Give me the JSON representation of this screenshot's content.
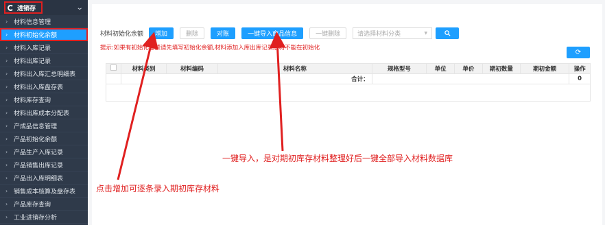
{
  "sidebar": {
    "title": "进销存",
    "items": [
      {
        "label": "材料信息管理"
      },
      {
        "label": "材料初始化余额"
      },
      {
        "label": "材料入库记录"
      },
      {
        "label": "材料出库记录"
      },
      {
        "label": "材料出入库汇总明细表"
      },
      {
        "label": "材料出入库盘存表"
      },
      {
        "label": "材料库存查询"
      },
      {
        "label": "材料出库成本分配表"
      },
      {
        "label": "产成品信息管理"
      },
      {
        "label": "产品初始化余额"
      },
      {
        "label": "产品生产入库记录"
      },
      {
        "label": "产品销售出库记录"
      },
      {
        "label": "产品出入库明细表"
      },
      {
        "label": "销售成本核算及盘存表"
      },
      {
        "label": "产品库存查询"
      },
      {
        "label": "工业进销存分析"
      }
    ]
  },
  "toolbar": {
    "label": "材料初始化余额",
    "add": "增加",
    "delete": "删除",
    "reconcile": "对账",
    "import": "一键导入商品信息",
    "delete_all": "一键删除",
    "category_placeholder": "请选择材料分类"
  },
  "hint": "提示:如果有初始化金额请先填写初始化余额,材料添加入库出库记录后将不能在初始化",
  "table": {
    "headers": [
      "材料类别",
      "材料编码",
      "材料名称",
      "规格型号",
      "单位",
      "单价",
      "期初数量",
      "期初金额",
      "操作"
    ],
    "total_label": "合计：",
    "total_value": "0"
  },
  "annotations": {
    "import_note": "一键导入，是对期初库存材料整理好后一键全部导入材料数据库",
    "add_note": "点击增加可逐条录入期初库存材料"
  },
  "colors": {
    "accent": "#1e9fff",
    "annotation": "#e02020",
    "sidebar_bg": "#2f3a4a"
  }
}
